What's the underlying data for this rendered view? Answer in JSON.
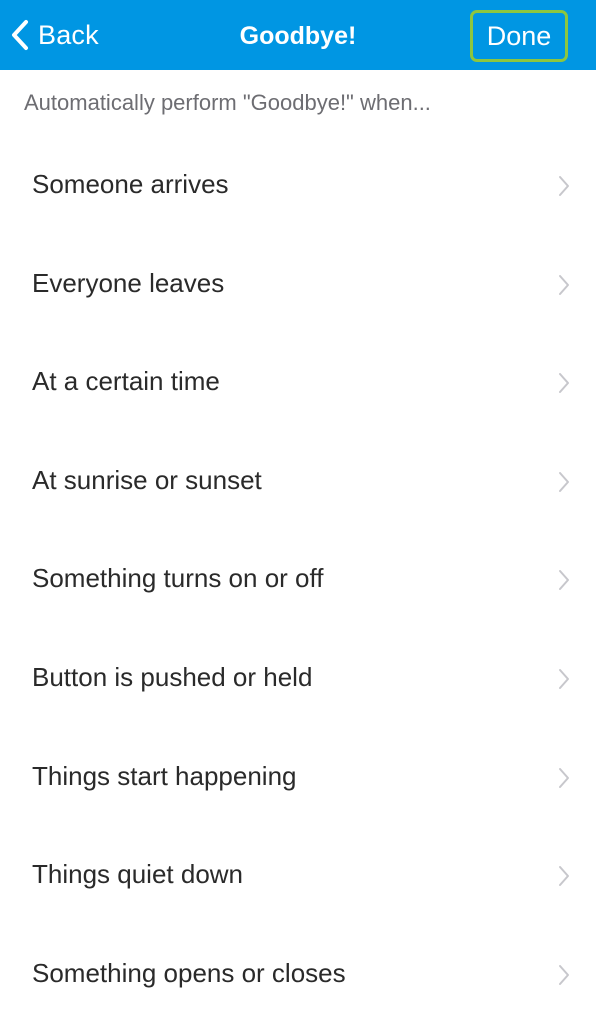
{
  "navbar": {
    "back_label": "Back",
    "title": "Goodbye!",
    "done_label": "Done",
    "background_color": "#0096e3",
    "done_highlight_color": "#8cc63f"
  },
  "section": {
    "header": "Automatically perform \"Goodbye!\" when..."
  },
  "triggers": [
    {
      "label": "Someone arrives"
    },
    {
      "label": "Everyone leaves"
    },
    {
      "label": "At a certain time"
    },
    {
      "label": "At sunrise or sunset"
    },
    {
      "label": "Something turns on or off"
    },
    {
      "label": "Button is pushed or held"
    },
    {
      "label": "Things start happening"
    },
    {
      "label": "Things quiet down"
    },
    {
      "label": "Something opens or closes"
    }
  ],
  "icons": {
    "back": "chevron-left-icon",
    "row_disclosure": "chevron-right-icon"
  }
}
